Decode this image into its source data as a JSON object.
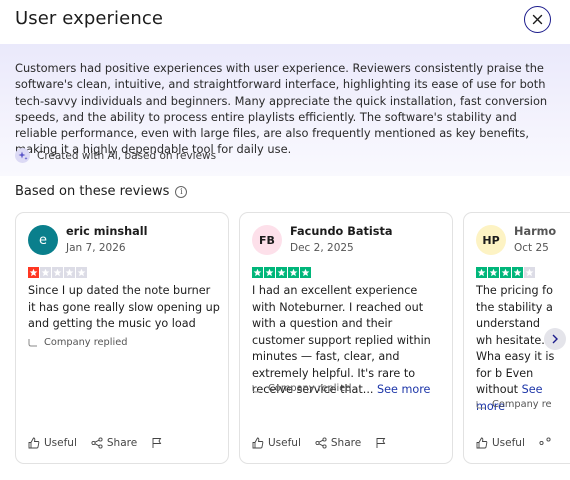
{
  "header": {
    "title": "User experience"
  },
  "summary": {
    "text": "Customers had positive experiences with user experience. Reviewers consistently praise the software's clean, intuitive, and straightforward interface, highlighting its ease of use for both tech-savvy individuals and beginners. Many appreciate the quick installation, fast conversion speeds, and the ability to process entire playlists efficiently. The software's stability and reliable performance, even with large files, are also frequently mentioned as key benefits, making it a highly dependable tool for daily use.",
    "ai_note": "Created with AI, based on reviews"
  },
  "reviews_section": {
    "title": "Based on these reviews"
  },
  "colors": {
    "trustpilot_green": "#00b67a",
    "one_star_red": "#ff3722",
    "empty_star": "#dcdce6",
    "link": "#1c35a8"
  },
  "reviews": [
    {
      "avatar_initials": "e",
      "avatar_bg": "#0a7f8c",
      "avatar_fg": "#ffffff",
      "name": "eric minshall",
      "date": "Jan 7, 2026",
      "rating": 1,
      "text": "Since I up dated the note burner it has gone really slow opening up and getting the music yo load",
      "see_more": "",
      "company_replied": "Company replied",
      "useful": "Useful",
      "share": "Share"
    },
    {
      "avatar_initials": "FB",
      "avatar_bg": "#fde0ea",
      "avatar_fg": "#1c1c1c",
      "name": "Facundo Batista",
      "date": "Dec 2, 2025",
      "rating": 5,
      "text": "I had an excellent experience with Noteburner. I reached out with a question and their customer support replied within minutes — fast, clear, and extremely helpful. It's rare to receive service that...",
      "see_more": "See more",
      "company_replied": "Company replied",
      "useful": "Useful",
      "share": "Share"
    },
    {
      "avatar_initials": "HP",
      "avatar_bg": "#fdf3c4",
      "avatar_fg": "#1c1c1c",
      "name": "Harmo",
      "date": "Oct 25",
      "rating": 4,
      "text": "The pricing fo the stability a understand wh hesitate. Wha easy it is for b Even without",
      "see_more": "See more",
      "company_replied": "Company re",
      "useful": "Useful",
      "share": ""
    }
  ]
}
